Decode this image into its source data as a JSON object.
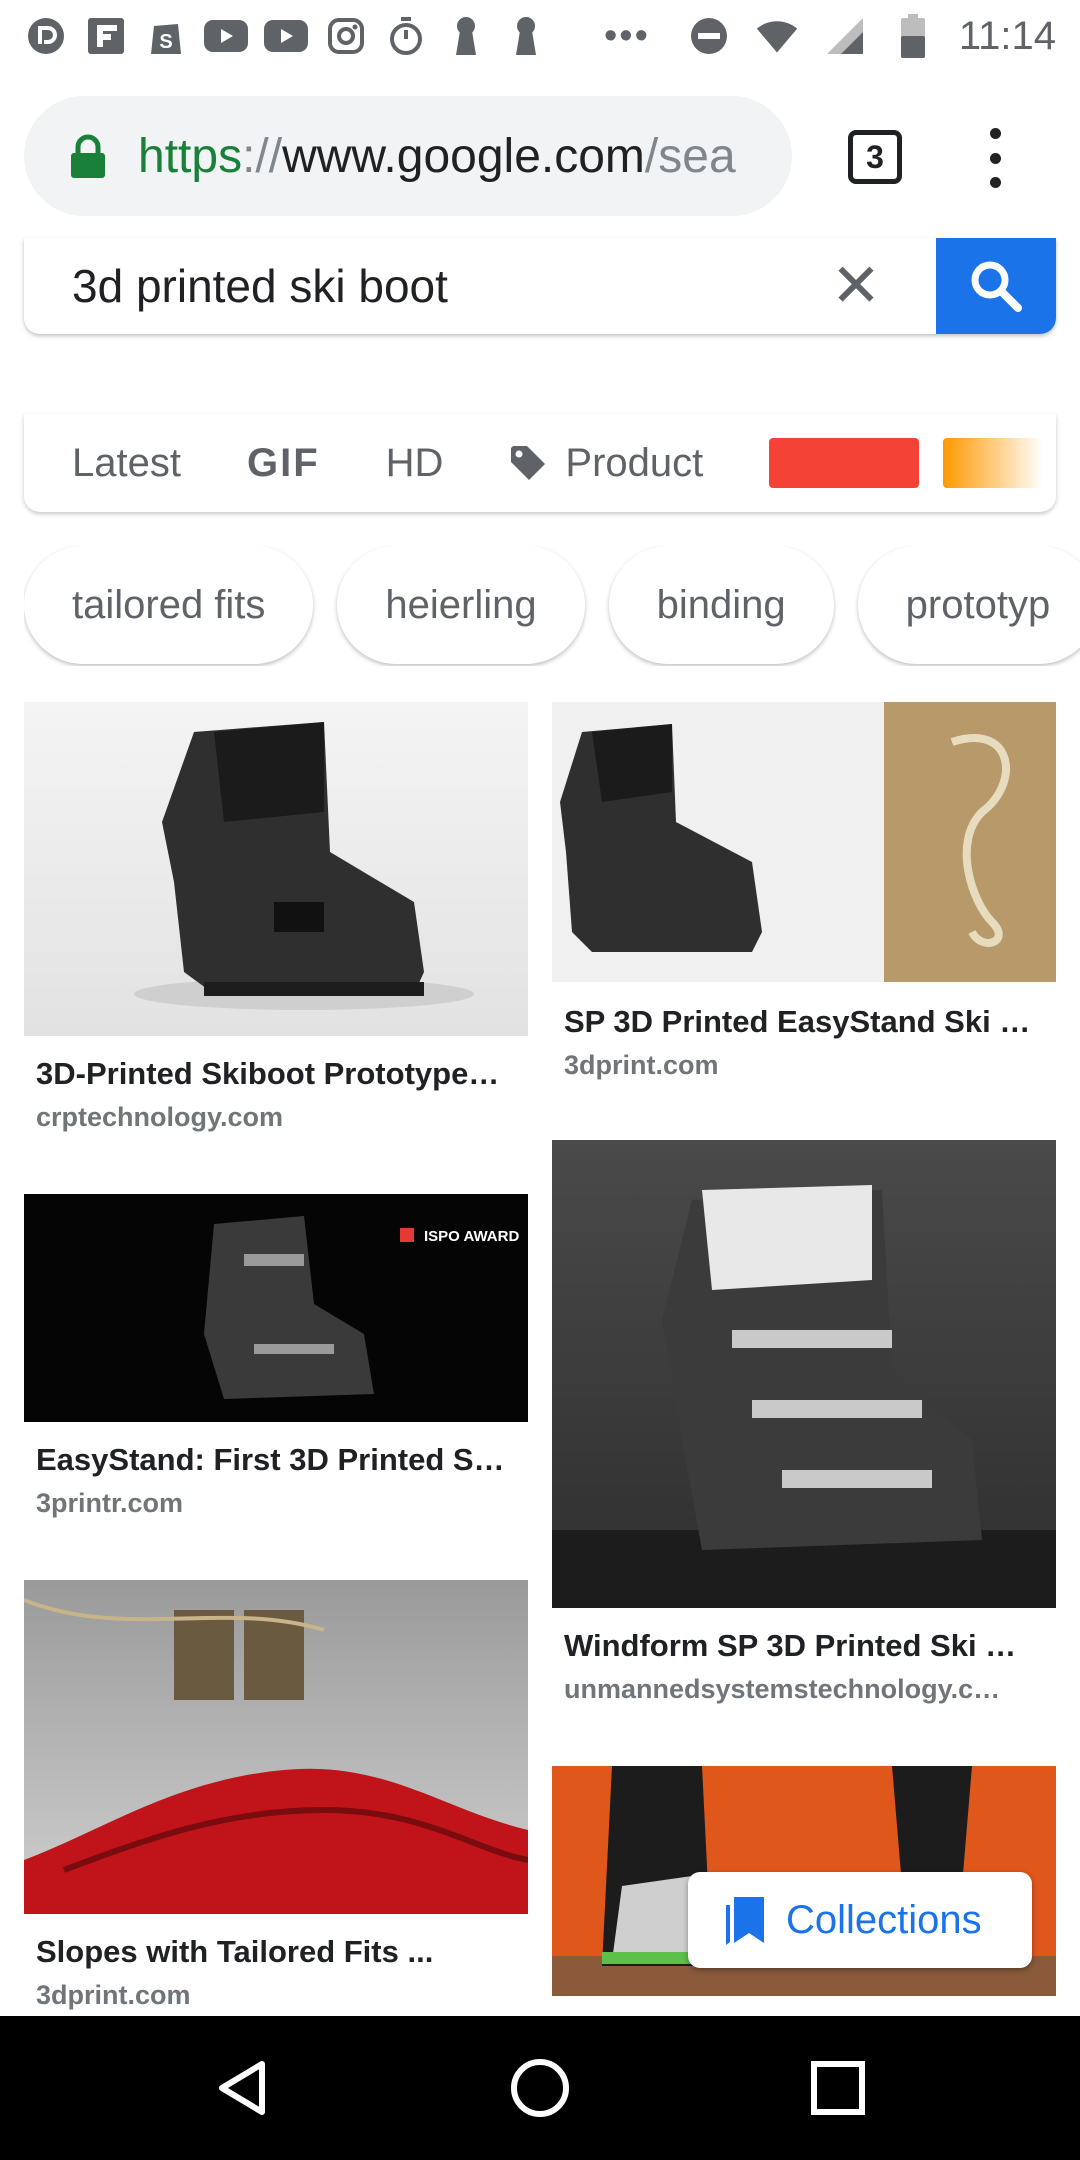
{
  "status_bar": {
    "time": "11:14",
    "overflow_dots": "•••",
    "left_icons": [
      "pocket-casts-icon",
      "flipboard-icon",
      "shopify-icon",
      "youtube-icon",
      "youtube-icon",
      "instagram-icon",
      "stopwatch-icon",
      "keyhole-icon",
      "keyhole-icon"
    ],
    "right_icons": [
      "do-not-disturb-icon",
      "wifi-icon",
      "signal-icon",
      "battery-icon"
    ]
  },
  "browser": {
    "url_scheme": "https",
    "url_separator": "://",
    "url_host": "www.google.com",
    "url_path": "/sea",
    "tab_count": "3"
  },
  "search": {
    "query": "3d printed ski boot",
    "clear_glyph": "✕"
  },
  "filters": {
    "items": [
      "Latest",
      "GIF",
      "HD",
      "Product"
    ],
    "color_swatches": [
      "#f44336",
      "#ff9800"
    ]
  },
  "chips": [
    "tailored fits",
    "heierling",
    "binding",
    "prototyp"
  ],
  "results": [
    {
      "title": "3D-Printed Skiboot Prototype…",
      "site": "crptechnology.com"
    },
    {
      "title": "SP 3D Printed EasyStand Ski …",
      "site": "3dprint.com"
    },
    {
      "title": "EasyStand: First 3D Printed S…",
      "site": "3printr.com",
      "image_text": "ISPO AWARD"
    },
    {
      "title": "Windform SP 3D Printed Ski …",
      "site": "unmannedsystemstechnology.c…"
    },
    {
      "title": "Slopes with Tailored Fits ...",
      "site": "3dprint.com"
    },
    {
      "title": "",
      "site": ""
    }
  ],
  "collections": {
    "label": "Collections"
  },
  "colors": {
    "accent_blue": "#1a73e8",
    "secure_green": "#188038",
    "text_secondary": "#5f6368"
  }
}
